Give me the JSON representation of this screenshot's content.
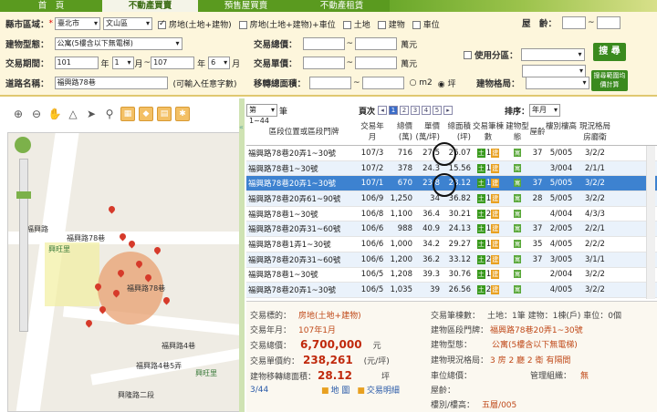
{
  "nav": {
    "tabs": [
      "首　頁",
      "不動產買賣",
      "預售屋買賣",
      "不動產租賃"
    ]
  },
  "filter": {
    "county_label": "縣市區域：",
    "county": "臺北市",
    "district": "文山區",
    "types": [
      "房地(土地+建物)",
      "房地(土地+建物)+車位",
      "土地",
      "建物",
      "車位"
    ],
    "building_type_label": "建物型態：",
    "building_type": "公寓(5樓含以下無電梯)",
    "period_label": "交易期間：",
    "period": {
      "y1": "101",
      "m1": "1",
      "y2": "107",
      "m2": "6",
      "year": "年",
      "month": "月",
      "to": "~"
    },
    "road_label": "道路名稱：",
    "road": "福興路78巷",
    "road_hint": "(可輸入任意字數)",
    "total_price_label": "交易總價：",
    "unit_price_label": "交易單價：",
    "area_label": "移轉總面積：",
    "wan": "萬元",
    "area_units": [
      "m2",
      "坪"
    ],
    "age_label": "屋　齡：",
    "use_zone_label": "使用分區：",
    "layout_label": "建物格局：",
    "search_btn": "搜 尋",
    "range_btn": "搜尋範圍均價計算"
  },
  "map": {
    "labels": [
      "興旺里",
      "福興路78巷",
      "福興路",
      "興旺里",
      "福興路4巷",
      "福興路4巷5弄",
      "興隆路二段"
    ]
  },
  "table": {
    "range": "第 1~44 筆",
    "page_label": "頁次",
    "pages": [
      "1",
      "2",
      "3",
      "4",
      "5"
    ],
    "sort_label": "排序：",
    "sort_value": "年月",
    "headers": [
      "區段位置或區段門牌",
      "交易年月",
      "總價(萬)",
      "單價(萬/坪)",
      "總面積(坪)",
      "交易筆棟數",
      "建物型態",
      "屋齡",
      "樓別樓高",
      "現況格局房廳衛"
    ],
    "rows": [
      {
        "addr": "福興路78巷20弄1~30號",
        "ym": "107/3",
        "total": "716",
        "unit": "27.5",
        "area": "26.07",
        "a": "土",
        "b": "1",
        "c": "建",
        "age": "37",
        "floor": "5/005",
        "layout": "3/2/2"
      },
      {
        "addr": "福興路78巷1~30號",
        "ym": "107/2",
        "total": "378",
        "unit": "24.3",
        "area": "15.56",
        "a": "土",
        "b": "1",
        "c": "建",
        "age": "",
        "floor": "3/004",
        "layout": "2/1/1"
      },
      {
        "addr": "福興路78巷20弄1~30號",
        "ym": "107/1",
        "total": "670",
        "unit": "23.8",
        "area": "28.12",
        "a": "土",
        "b": "1",
        "c": "建",
        "age": "37",
        "floor": "5/005",
        "layout": "3/2/2"
      },
      {
        "addr": "福興路78巷20弄61~90號",
        "ym": "106/9",
        "total": "1,250",
        "unit": "34",
        "area": "36.82",
        "a": "土",
        "b": "1",
        "c": "建",
        "age": "28",
        "floor": "5/005",
        "layout": "3/2/2"
      },
      {
        "addr": "福興路78巷1~30號",
        "ym": "106/8",
        "total": "1,100",
        "unit": "36.4",
        "area": "30.21",
        "a": "土",
        "b": "2",
        "c": "建",
        "age": "",
        "floor": "4/004",
        "layout": "4/3/3"
      },
      {
        "addr": "福興路78巷20弄31~60號",
        "ym": "106/6",
        "total": "988",
        "unit": "40.9",
        "area": "24.13",
        "a": "土",
        "b": "1",
        "c": "建",
        "age": "37",
        "floor": "2/005",
        "layout": "2/2/1"
      },
      {
        "addr": "福興路78巷1弄1~30號",
        "ym": "106/6",
        "total": "1,000",
        "unit": "34.2",
        "area": "29.27",
        "a": "土",
        "b": "1",
        "c": "建",
        "age": "35",
        "floor": "4/005",
        "layout": "2/2/2"
      },
      {
        "addr": "福興路78巷20弄31~60號",
        "ym": "106/6",
        "total": "1,200",
        "unit": "36.2",
        "area": "33.12",
        "a": "土",
        "b": "2",
        "c": "建",
        "age": "37",
        "floor": "3/005",
        "layout": "3/1/1"
      },
      {
        "addr": "福興路78巷1~30號",
        "ym": "106/5",
        "total": "1,208",
        "unit": "39.3",
        "area": "30.76",
        "a": "土",
        "b": "1",
        "c": "建",
        "age": "",
        "floor": "2/004",
        "layout": "3/2/2"
      },
      {
        "addr": "福興路78巷20弄1~30號",
        "ym": "106/5",
        "total": "1,035",
        "unit": "39",
        "area": "26.56",
        "a": "土",
        "b": "2",
        "c": "建",
        "age": "",
        "floor": "4/005",
        "layout": "3/2/2"
      }
    ]
  },
  "detail": {
    "target_label": "交易標的：",
    "target": "房地(土地+建物)",
    "ym_label": "交易年月：",
    "ym": "107年1月",
    "total_label": "交易總價：",
    "total": "6,700,000",
    "total_unit": "元",
    "unit_label": "交易單價約：",
    "unit": "238,261",
    "unit_unit": "(元/坪)",
    "area_label": "建物移轉總面積：",
    "area": "28.12",
    "area_unit": "坪",
    "counter": "3/44",
    "map_link": "地 圖",
    "detail_link": "交易明細",
    "count_label": "交易筆棟數：",
    "count": "土地：1筆 建物：1棟(戶) 車位：0個",
    "addr_label": "建物區段門牌：",
    "addr": "福興路78巷20弄1~30號",
    "btype_label": "建物型態：",
    "btype": "公寓(5樓含以下無電梯)",
    "layout_label": "建物現況格局：",
    "layout": "3 房 2 廳 2 衛 有隔間",
    "parking_label": "車位總價：",
    "mgmt_label": "管理組織：",
    "mgmt": "無",
    "age_label": "屋齡：",
    "floor_label": "樓別/樓高：",
    "floor": "五層/005"
  }
}
